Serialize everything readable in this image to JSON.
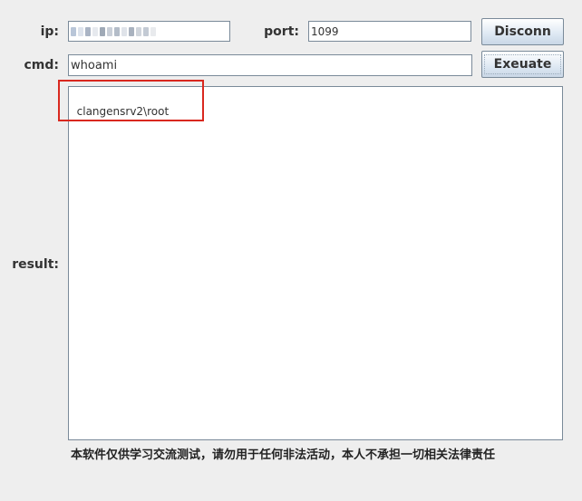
{
  "connection": {
    "ip_label": "ip:",
    "port_label": "port:",
    "port_value": "1099",
    "disconnect_label": "Disconn"
  },
  "command": {
    "cmd_label": "cmd:",
    "cmd_value": "whoami",
    "execute_label": "Exeuate"
  },
  "result": {
    "label": "result:",
    "text": "clangensrv2\\root"
  },
  "disclaimer": "本软件仅供学习交流测试，请勿用于任何非法活动，本人不承担一切相关法律责任",
  "colors": {
    "highlight": "#d9281f"
  }
}
